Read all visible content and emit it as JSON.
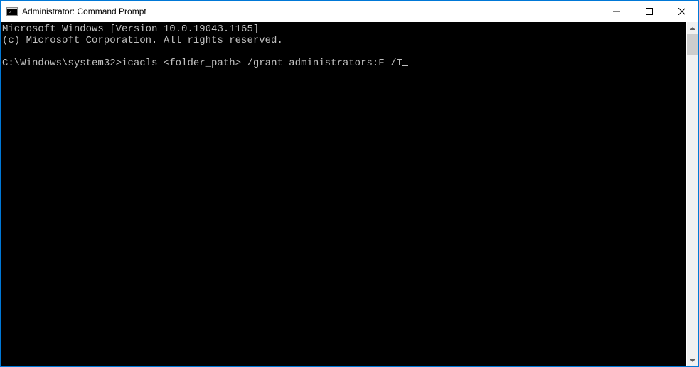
{
  "window": {
    "title": "Administrator: Command Prompt"
  },
  "terminal": {
    "line1": "Microsoft Windows [Version 10.0.19043.1165]",
    "line2": "(c) Microsoft Corporation. All rights reserved.",
    "blank": "",
    "prompt": "C:\\Windows\\system32>",
    "command": "icacls <folder_path> /grant administrators:F /T"
  }
}
